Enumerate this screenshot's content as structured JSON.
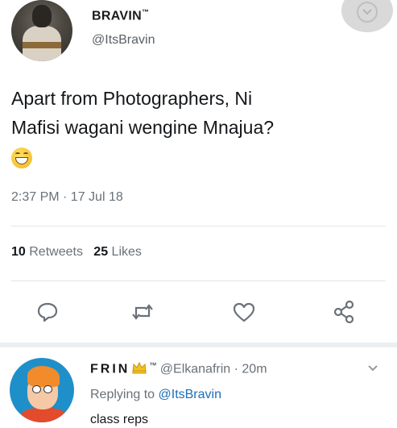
{
  "tweet": {
    "author_name": "BRAVIN",
    "author_tm": "™",
    "author_handle": "@ItsBravin",
    "text_line1": "Apart from Photographers, Ni",
    "text_line2": "Mafisi wagani wengine Mnajua?",
    "timestamp": "2:37 PM · 17 Jul 18",
    "retweets_count": "10",
    "retweets_label": "Retweets",
    "likes_count": "25",
    "likes_label": "Likes"
  },
  "reply": {
    "name": "FRIN",
    "tm": "™",
    "handle": "@Elkanafrin",
    "time": " · 20m",
    "replying_prefix": "Replying to ",
    "replying_to": "@ItsBravin",
    "text": "class reps"
  },
  "icons": {
    "reply": "reply-icon",
    "retweet": "retweet-icon",
    "like": "heart-icon",
    "share": "share-icon",
    "menu": "chevron-down-icon",
    "crown": "crown-emoji",
    "emoji": "grinning-emoji"
  },
  "colors": {
    "text": "#14171a",
    "secondary": "#6a7178",
    "link": "#1d6fb8",
    "divider": "#e1e5e8"
  }
}
